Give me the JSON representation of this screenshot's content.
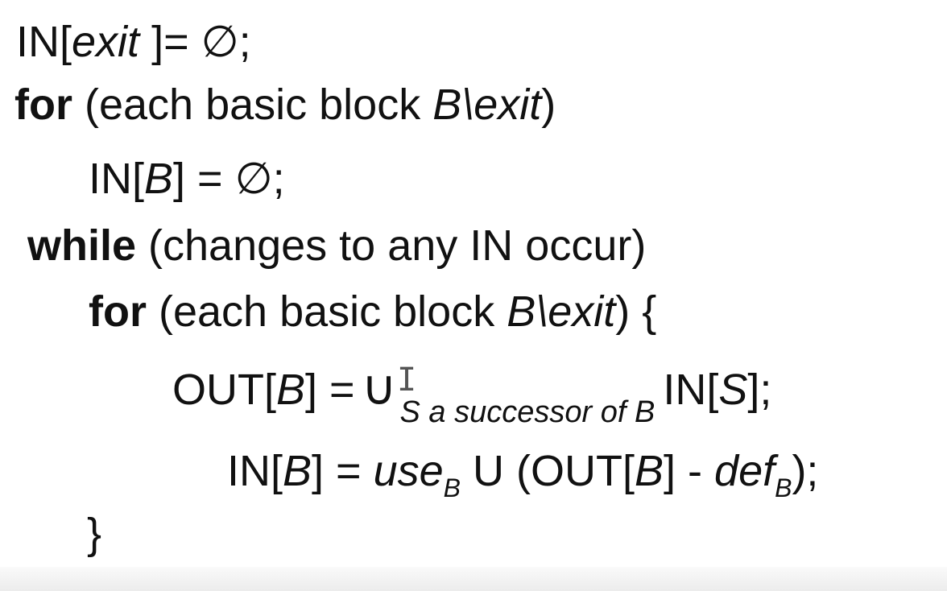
{
  "lines": {
    "l1": {
      "a": "IN[",
      "b": "exit",
      "c": " ]= ∅;"
    },
    "l2": {
      "kw": "for",
      "a": " (each basic block ",
      "b": "B\\exit",
      "c": ")"
    },
    "l3": {
      "a": "IN[",
      "b": "B",
      "c": "] = ∅;"
    },
    "l4": {
      "kw": "while",
      "a": " (changes to any IN occur)"
    },
    "l5": {
      "kw": "for",
      "a": " (each basic block ",
      "b": "B\\exit",
      "c": ") {"
    },
    "l6": {
      "a": "OUT[",
      "b": "B",
      "c": "] =",
      "union": "∪",
      "sub": "S a successor of B",
      "d": "IN[",
      "e": "S",
      "f": "];"
    },
    "l7": {
      "a": "IN[",
      "b": "B",
      "c": "] = ",
      "use": "use",
      "use_sub": "B",
      "d": " U (OUT[",
      "e": "B",
      "f": "] - ",
      "def": "def",
      "def_sub": "B",
      "g": ");"
    },
    "l8": {
      "brace": "}"
    }
  },
  "icons": {
    "cursor": "text-cursor-icon"
  }
}
